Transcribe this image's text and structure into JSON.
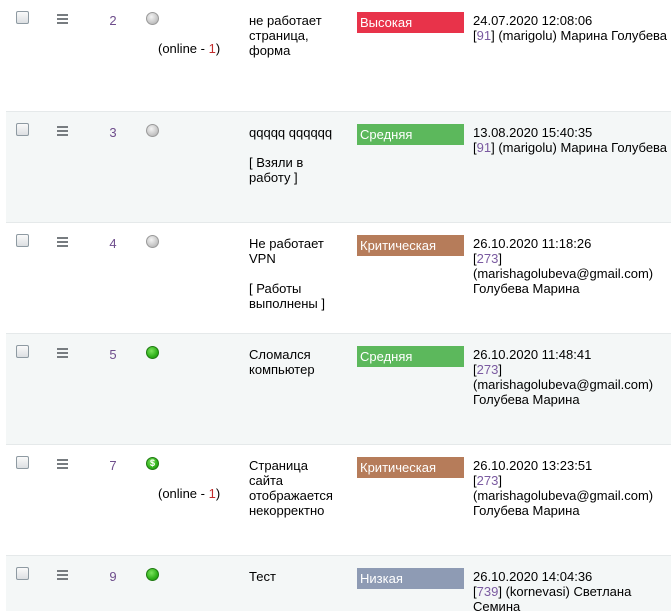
{
  "rows": [
    {
      "id": "2",
      "status": "grey",
      "online_prefix": "(online - ",
      "online_count": "1",
      "online_suffix": ")",
      "title": "не работает страница, форма",
      "subtitle": "",
      "priority": "Высокая",
      "priority_color": "#e8334a",
      "date": "24.07.2020 12:08:06",
      "uid": "91",
      "user_login": "(marigolu) Марина Голубева",
      "user_name": ""
    },
    {
      "id": "3",
      "status": "grey",
      "online_prefix": "",
      "online_count": "",
      "online_suffix": "",
      "title": "qqqqq qqqqqq",
      "subtitle": "[ Взяли в работу ]",
      "priority": "Средняя",
      "priority_color": "#5cb85c",
      "date": "13.08.2020 15:40:35",
      "uid": "91",
      "user_login": "(marigolu) Марина Голубева",
      "user_name": ""
    },
    {
      "id": "4",
      "status": "grey",
      "online_prefix": "",
      "online_count": "",
      "online_suffix": "",
      "title": "Не работает VPN",
      "subtitle": "[ Работы выполнены ]",
      "priority": "Критическая",
      "priority_color": "#b67c5a",
      "date": "26.10.2020 11:18:26",
      "uid": "273",
      "user_login": "(marishagolubeva@gmail.com)",
      "user_name": "Голубева Марина"
    },
    {
      "id": "5",
      "status": "green",
      "online_prefix": "",
      "online_count": "",
      "online_suffix": "",
      "title": "Сломался компьютер",
      "subtitle": "",
      "priority": "Средняя",
      "priority_color": "#5cb85c",
      "date": "26.10.2020 11:48:41",
      "uid": "273",
      "user_login": "(marishagolubeva@gmail.com)",
      "user_name": "Голубева Марина"
    },
    {
      "id": "7",
      "status": "green-dollar",
      "online_prefix": "(online - ",
      "online_count": "1",
      "online_suffix": ")",
      "title": "Страница сайта отображается некорректно",
      "subtitle": "",
      "priority": "Критическая",
      "priority_color": "#b67c5a",
      "date": "26.10.2020 13:23:51",
      "uid": "273",
      "user_login": "(marishagolubeva@gmail.com)",
      "user_name": "Голубева Марина"
    },
    {
      "id": "9",
      "status": "green",
      "online_prefix": "",
      "online_count": "",
      "online_suffix": "",
      "title": "Тест",
      "subtitle": "",
      "priority": "Низкая",
      "priority_color": "#8e9bb4",
      "date": "26.10.2020 14:04:36",
      "uid": "739",
      "user_login": "(kornevasi) Светлана Семина",
      "user_name": ""
    }
  ],
  "status_icon_names": {
    "grey": "offline-status-icon",
    "green": "online-status-icon",
    "green-dollar": "paid-status-icon"
  },
  "dollar_glyph": "$"
}
